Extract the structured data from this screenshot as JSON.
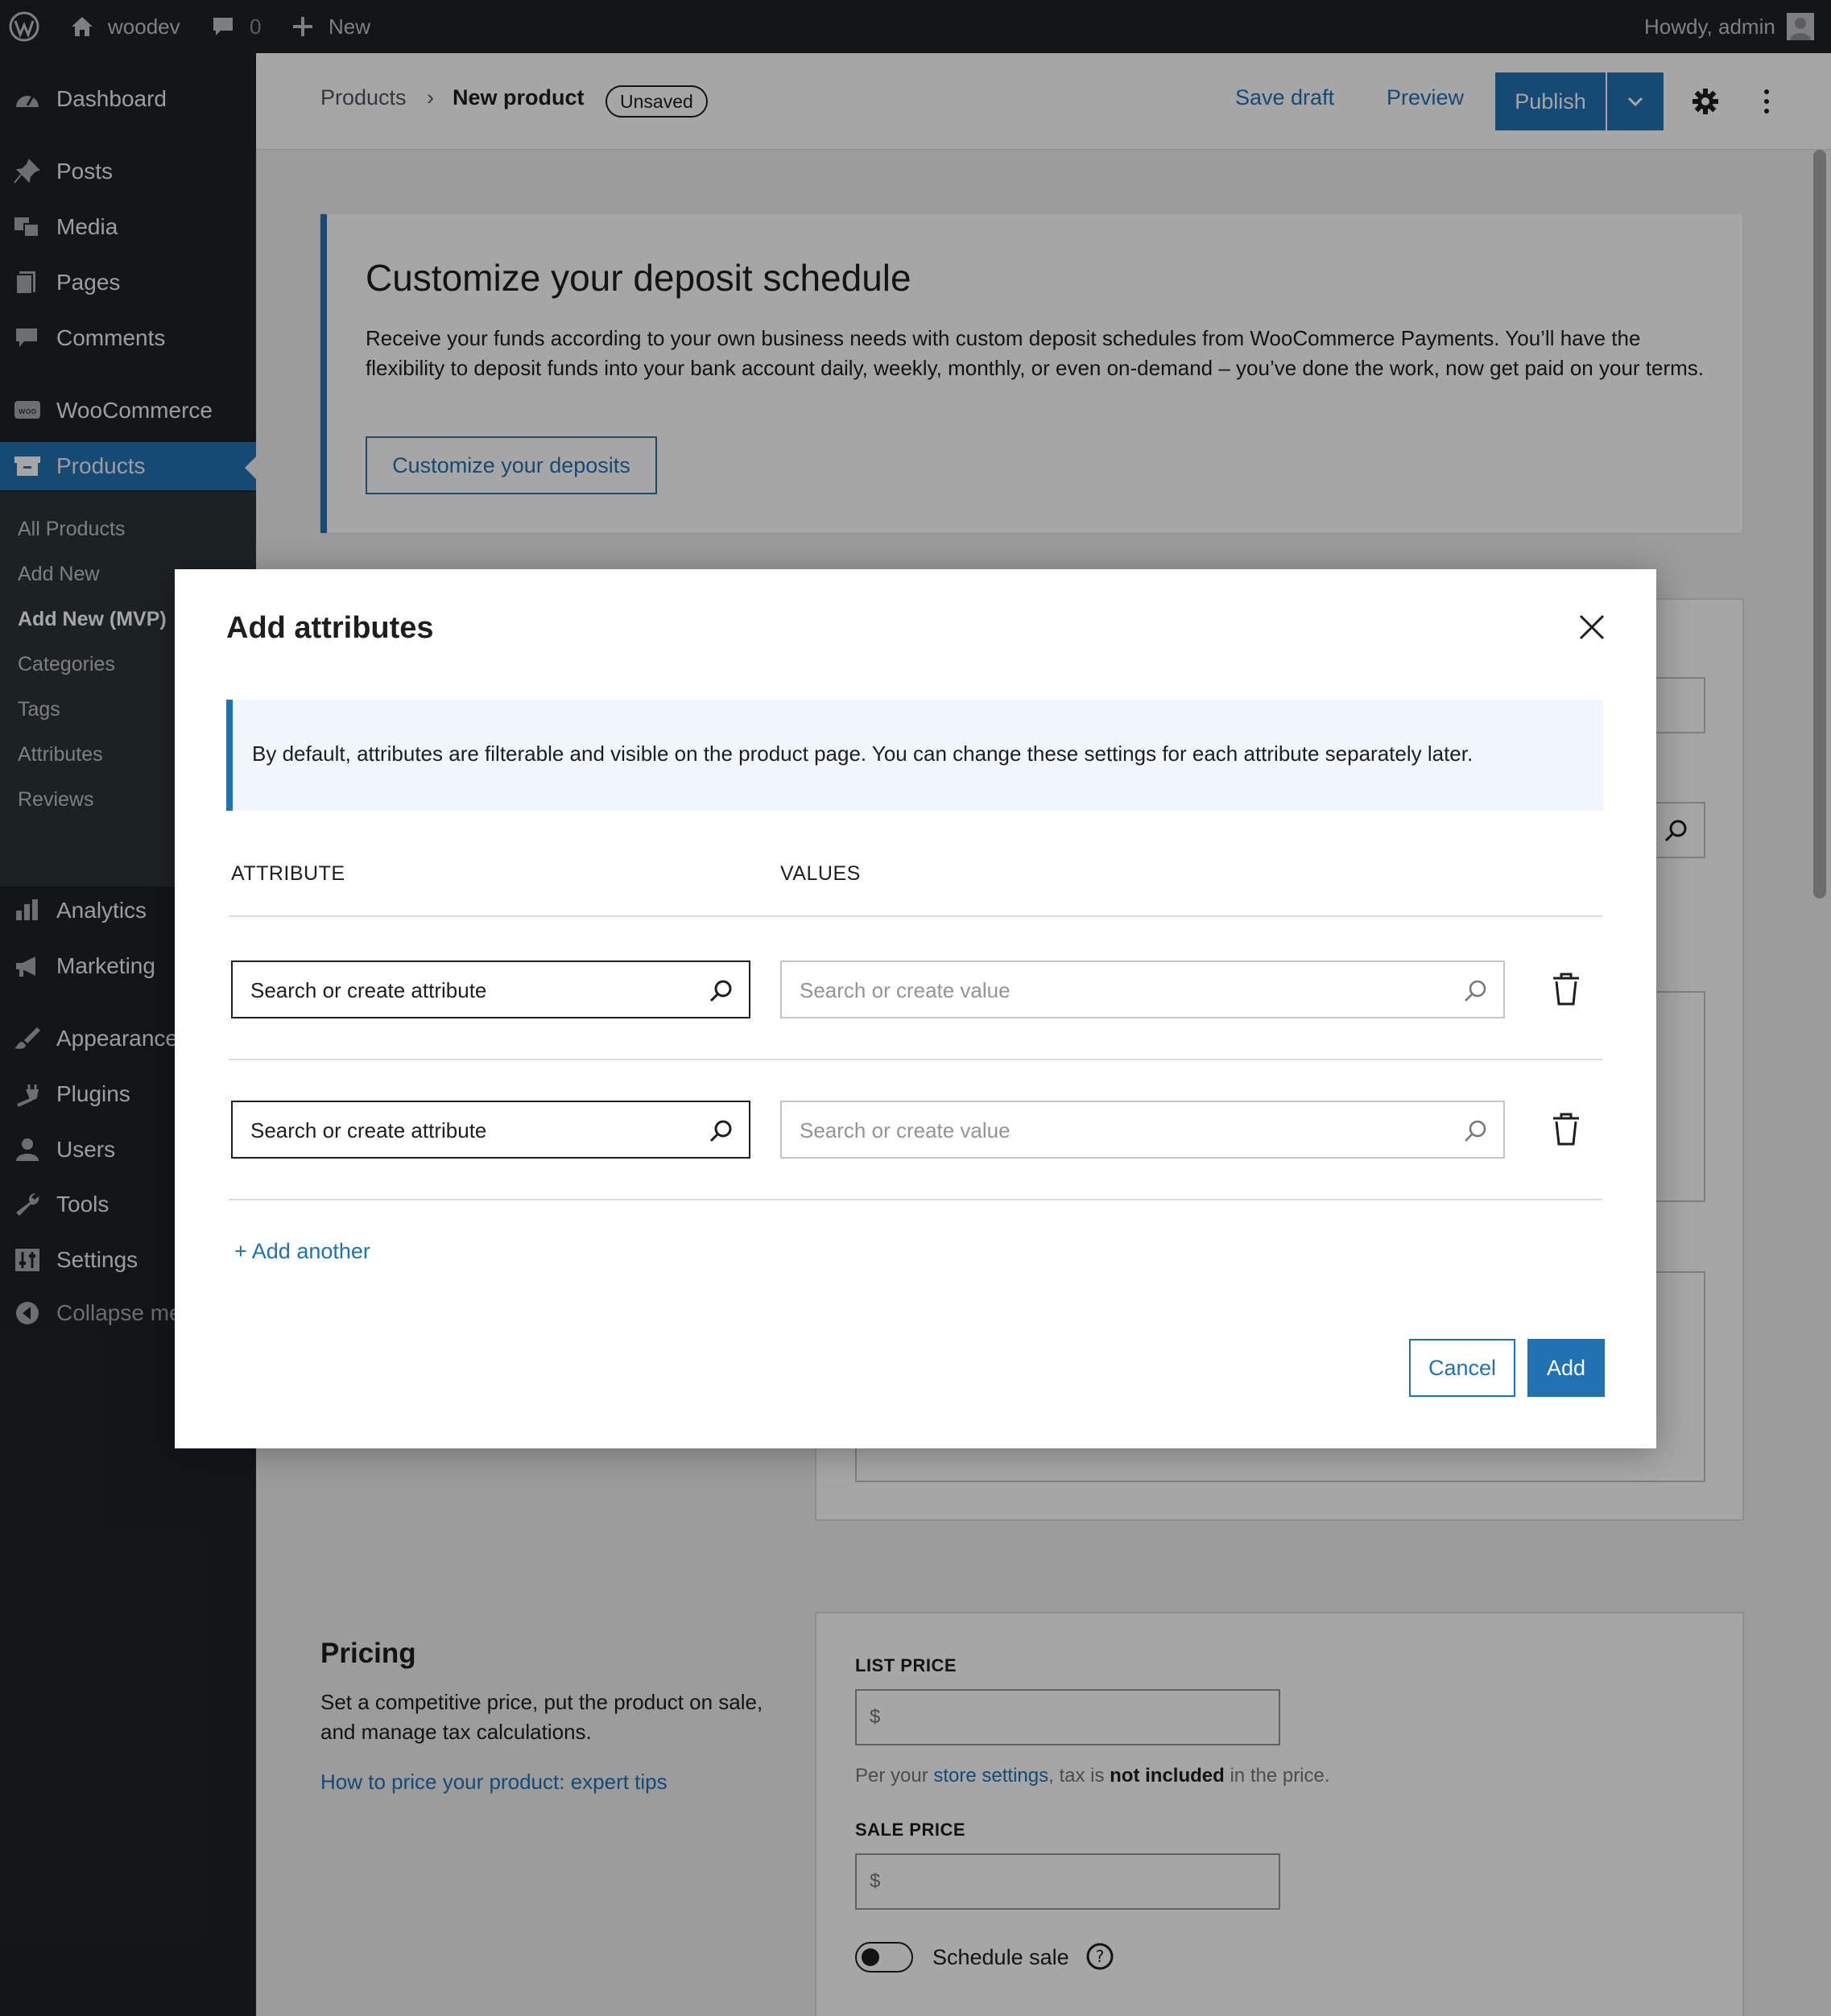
{
  "admin_bar": {
    "site_name": "woodev",
    "comments_count": "0",
    "new_label": "New",
    "howdy": "Howdy, admin"
  },
  "sidebar": {
    "items": [
      {
        "label": "Dashboard",
        "icon": "dashboard-icon"
      },
      {
        "label": "Posts",
        "icon": "pin-icon"
      },
      {
        "label": "Media",
        "icon": "media-icon"
      },
      {
        "label": "Pages",
        "icon": "pages-icon"
      },
      {
        "label": "Comments",
        "icon": "comment-icon"
      },
      {
        "label": "WooCommerce",
        "icon": "woo-icon"
      },
      {
        "label": "Products",
        "icon": "archive-icon"
      },
      {
        "label": "Analytics",
        "icon": "bar-chart-icon"
      },
      {
        "label": "Marketing",
        "icon": "megaphone-icon"
      },
      {
        "label": "Appearance",
        "icon": "brush-icon"
      },
      {
        "label": "Plugins",
        "icon": "plug-icon"
      },
      {
        "label": "Users",
        "icon": "user-icon"
      },
      {
        "label": "Tools",
        "icon": "wrench-icon"
      },
      {
        "label": "Settings",
        "icon": "settings-sliders-icon"
      },
      {
        "label": "Collapse menu",
        "icon": "collapse-arrow-icon"
      }
    ],
    "submenu": [
      {
        "label": "All Products"
      },
      {
        "label": "Add New"
      },
      {
        "label": "Add New (MVP)"
      },
      {
        "label": "Categories"
      },
      {
        "label": "Tags"
      },
      {
        "label": "Attributes"
      },
      {
        "label": "Reviews"
      }
    ]
  },
  "header": {
    "breadcrumb_parent": "Products",
    "breadcrumb_sep": "›",
    "title": "New product",
    "badge": "Unsaved",
    "save_draft": "Save draft",
    "preview": "Preview",
    "publish": "Publish"
  },
  "banner": {
    "title": "Customize your deposit schedule",
    "body": "Receive your funds according to your own business needs with custom deposit schedules from WooCommerce Payments. You’ll have the flexibility to deposit funds into your bank account daily, weekly, monthly, or even on-demand – you’ve done the work, now get paid on your terms.",
    "button": "Customize your deposits"
  },
  "pricing": {
    "title": "Pricing",
    "description": "Set a competitive price, put the product on sale, and manage tax calculations.",
    "link": "How to price your product: expert tips",
    "list_price_label": "LIST PRICE",
    "currency": "$",
    "help_prefix": "Per your ",
    "help_link": "store settings",
    "help_middle": ", tax is ",
    "help_bold": "not included",
    "help_suffix": " in the price.",
    "sale_price_label": "SALE PRICE",
    "schedule_sale": "Schedule sale"
  },
  "modal": {
    "title": "Add attributes",
    "notice": "By default, attributes are filterable and visible on the product page. You can change these settings for each attribute separately later.",
    "col_attribute": "ATTRIBUTE",
    "col_values": "VALUES",
    "rows": [
      {
        "attribute_placeholder": "Search or create attribute",
        "value_placeholder": "Search or create value"
      },
      {
        "attribute_placeholder": "Search or create attribute",
        "value_placeholder": "Search or create value"
      }
    ],
    "add_another": "+ Add another",
    "cancel": "Cancel",
    "add": "Add"
  },
  "colors": {
    "accent": "#2271b1",
    "admin_dark": "#1d2327",
    "notice_bg": "#f0f6fc"
  }
}
